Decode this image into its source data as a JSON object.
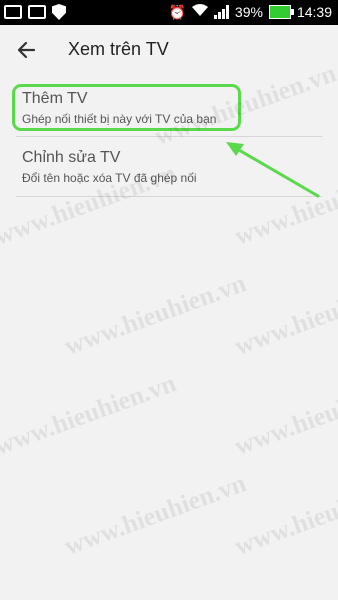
{
  "status_bar": {
    "battery_percent": "39%",
    "time": "14:39",
    "icons": [
      "notification-box-icon",
      "gallery-icon",
      "shield-icon",
      "alarm-icon",
      "wifi-icon",
      "signal-icon",
      "battery-charging-icon"
    ]
  },
  "app_bar": {
    "title": "Xem trên TV",
    "back_icon": "back-arrow-icon"
  },
  "list": {
    "items": [
      {
        "title": "Thêm TV",
        "subtitle": "Ghép nối thiết bị này với TV của bạn"
      },
      {
        "title": "Chỉnh sửa TV",
        "subtitle": "Đổi tên hoặc xóa TV đã ghép nối"
      }
    ]
  },
  "annotation": {
    "highlight_color": "#5bd94c",
    "arrow_color": "#5bd94c"
  },
  "watermark": {
    "text": "www.hieuhien.vn"
  }
}
